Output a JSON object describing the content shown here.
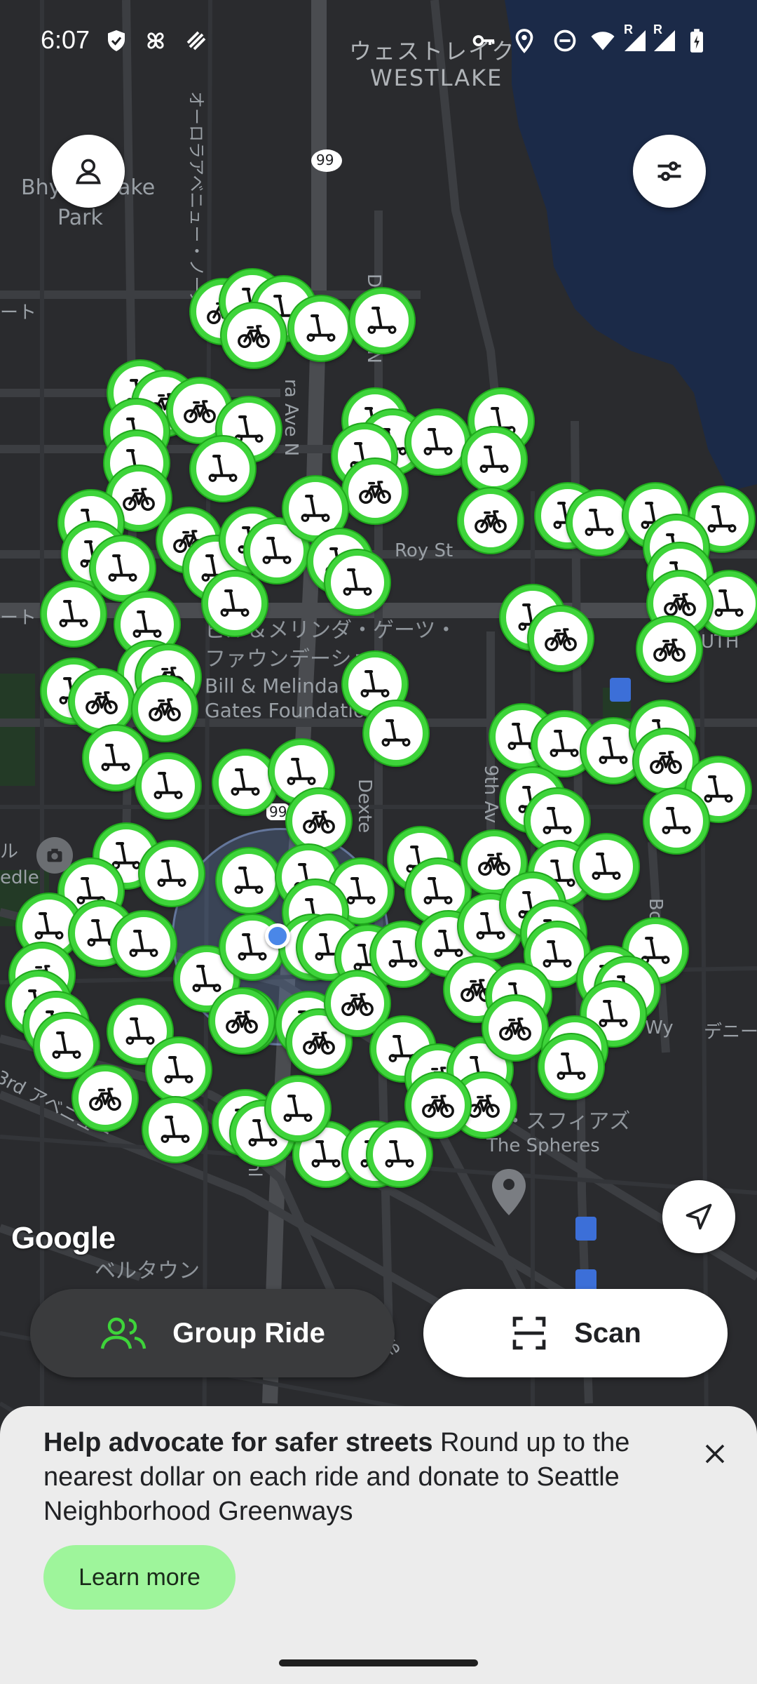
{
  "status_bar": {
    "time": "6:07",
    "icons": [
      "shield-icon",
      "pinwheel-icon",
      "stripes-icon",
      "key-icon",
      "location-icon",
      "do-not-disturb-icon",
      "wifi-icon",
      "signal-icon",
      "signal-icon",
      "battery-charging-icon"
    ],
    "roaming_label": "R"
  },
  "map": {
    "labels": {
      "westlake_jp": "ウェストレイク",
      "westlake_en": "WESTLAKE",
      "park": "Bhy   Kracke\nPark",
      "park_line1": "Bhy",
      "park_line1b": "ake",
      "park_line2": "Park",
      "highway_99": "99",
      "highway_99b": "99",
      "roy_st": "Roy St",
      "aurora_ave": "ra Ave N",
      "dexter_ave": "D      e Ave N",
      "dexter_short": "Dexte",
      "ninth_ave": "9th Av",
      "gates_jp_1": "ビル＆メリンダ・ゲーツ・",
      "gates_jp_2": "ファウンデーション",
      "gates_en_1": "Bill & Melinda",
      "gates_en_2": "Gates Foundation",
      "spheres_jp": "・スフィアズ",
      "spheres_en": "The Spheres",
      "belltown_jp": "ベルタウン",
      "third_ave_jp": "3rd アベニュー",
      "tunnel": "e 99 Tunl",
      "ave": "Ave",
      "wy": "Wy",
      "deni": "デニー",
      "left_edge_1": "ート",
      "left_edge_2": "ート",
      "left_edge_3": "ル",
      "left_edge_4": "edle",
      "bo": "Bo",
      "n": "n",
      "uth": "UTH",
      "aurora_jp": "オーロラアベニュー・ノース"
    },
    "attribution": "Google"
  },
  "buttons": {
    "group_ride_label": "Group Ride",
    "scan_label": "Scan"
  },
  "banner": {
    "title": "Help advocate for safer streets",
    "body": " Round up to the nearest dollar on each ride and donate to Seattle Neighborhood Greenways",
    "cta_label": "Learn more"
  },
  "colors": {
    "marker_ring": "#3ed43a",
    "cta_background": "#9ef59b",
    "user_dot": "#4a87e8",
    "water": "#1b2a48"
  }
}
